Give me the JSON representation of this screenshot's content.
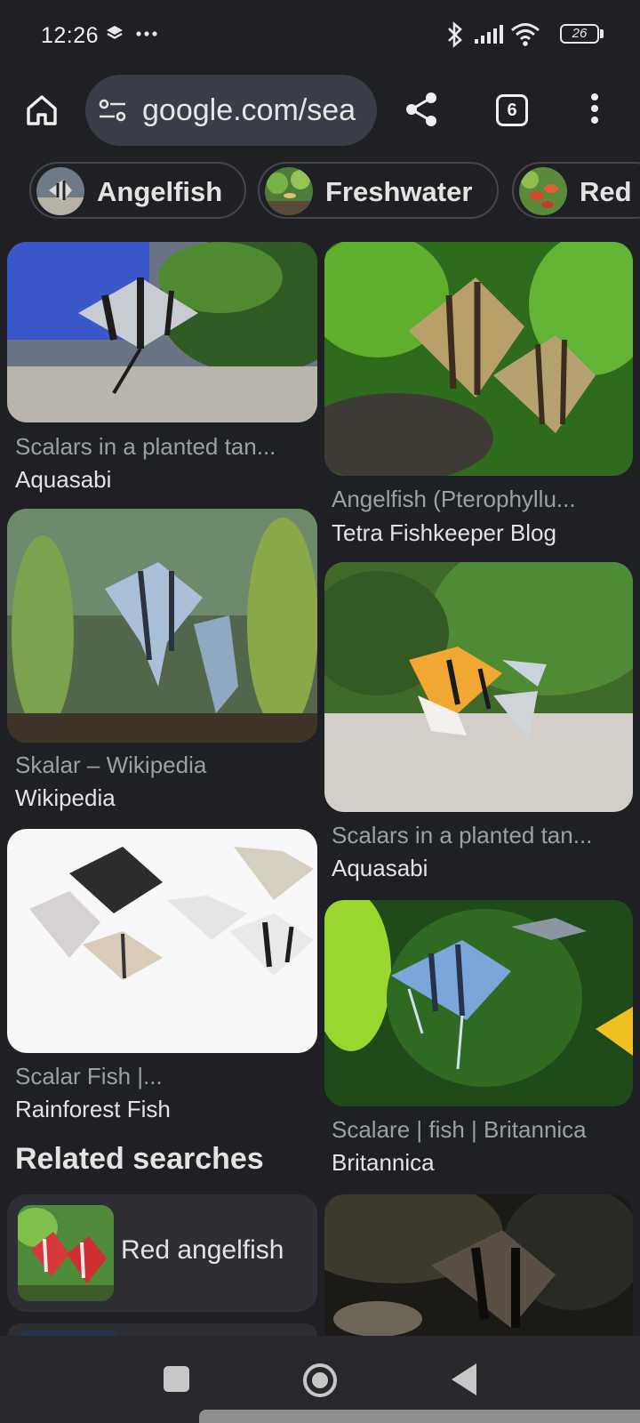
{
  "status_bar": {
    "time": "12:26",
    "battery": "26",
    "icons": [
      "layers-icon",
      "more-notifications-icon",
      "bluetooth-icon",
      "signal-icon",
      "wifi-icon",
      "battery-icon"
    ]
  },
  "toolbar": {
    "url": "google.com/sea",
    "tab_count": "6",
    "icons": [
      "home-icon",
      "site-settings-icon",
      "share-icon",
      "tabs-icon",
      "more-menu-icon"
    ]
  },
  "chips": [
    {
      "label": "Angelfish"
    },
    {
      "label": "Freshwater"
    },
    {
      "label": "Red"
    }
  ],
  "results": {
    "left": [
      {
        "caption": "Scalars in a planted tan...",
        "source": "Aquasabi"
      },
      {
        "caption": "Skalar – Wikipedia",
        "source": "Wikipedia"
      },
      {
        "caption": "Scalar Fish |...",
        "source": "Rainforest Fish"
      }
    ],
    "right": [
      {
        "caption": "Angelfish (Pterophyllu...",
        "source": "Tetra Fishkeeper Blog"
      },
      {
        "caption": "Scalars in a planted tan...",
        "source": "Aquasabi"
      },
      {
        "caption": "Scalare | fish | Britannica",
        "source": "Britannica"
      }
    ]
  },
  "related": {
    "title": "Related searches",
    "items": [
      {
        "label": "Red angelfish"
      }
    ]
  },
  "colors": {
    "background": "#1f2023",
    "url_pill": "#3a3d47",
    "chip_border": "#44464c",
    "caption": "#9aa0a6",
    "text": "#e3e3e3"
  }
}
